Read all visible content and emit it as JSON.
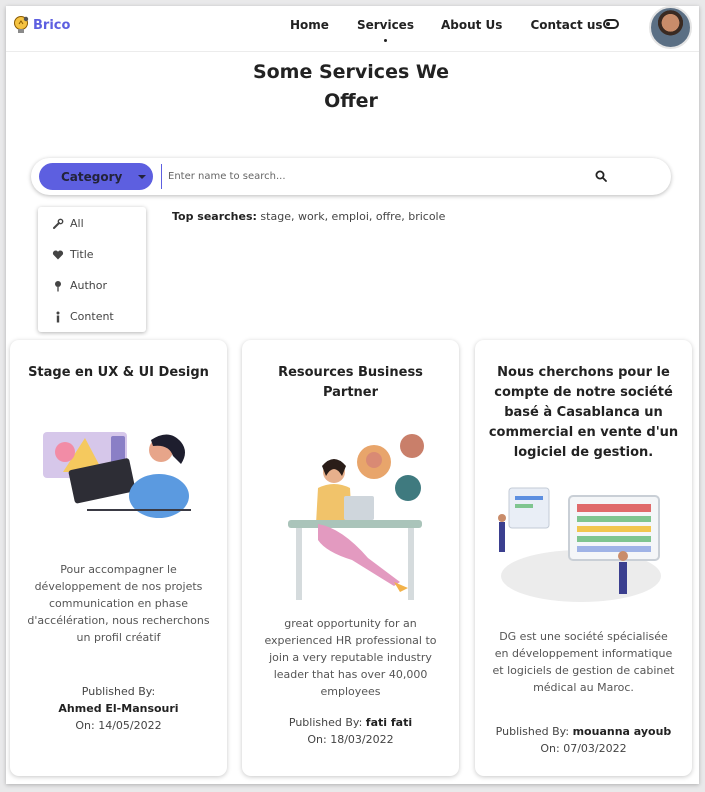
{
  "nav": {
    "brand": "Brico",
    "links": [
      "Home",
      "Services",
      "About Us",
      "Contact us"
    ],
    "active": "Services"
  },
  "page": {
    "title_line1": "Some Services We",
    "title_line2": "Offer"
  },
  "search": {
    "category_label": "Category",
    "placeholder": "Enter name to search...",
    "top_label": "Top searches:",
    "top_terms": "stage, work, emploi, offre, bricole"
  },
  "dropdown": {
    "items": [
      {
        "label": "All",
        "icon": "wrench-icon"
      },
      {
        "label": "Title",
        "icon": "heart-icon"
      },
      {
        "label": "Author",
        "icon": "pin-icon"
      },
      {
        "label": "Content",
        "icon": "info-icon"
      }
    ]
  },
  "cards": [
    {
      "title": "Stage en UX & UI Design",
      "description": "Pour accompagner le développement de nos projets communication en phase d'accélération, nous recherchons un profil créatif",
      "published_label": "Published By:",
      "author": "Ahmed El-Mansouri",
      "date_label": "On:",
      "date": "14/05/2022"
    },
    {
      "title": "Resources Business Partner",
      "description": "great opportunity for an experienced HR professional to join a very reputable industry leader that has over 40,000 employees",
      "published_label": "Published By:",
      "author": "fati fati",
      "date_label": "On:",
      "date": "18/03/2022"
    },
    {
      "title": "Nous cherchons pour le compte de notre société basé à Casablanca un commercial en vente d'un logiciel de gestion.",
      "description": "DG est une société spécialisée en développement informatique et logiciels de gestion de cabinet médical au Maroc.",
      "published_label": "Published By:",
      "author": "mouanna ayoub",
      "date_label": "On:",
      "date": "07/03/2022"
    }
  ],
  "colors": {
    "accent": "#5d5fe0",
    "text": "#222222",
    "muted": "#555555"
  }
}
